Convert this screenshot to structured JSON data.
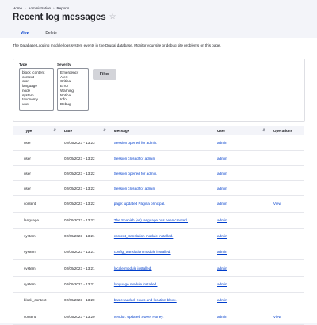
{
  "breadcrumb": [
    "Home",
    "Administration",
    "Reports"
  ],
  "breadcrumb_sep": "›",
  "page_title": "Recent log messages",
  "tabs": [
    {
      "label": "View"
    },
    {
      "label": "Delete"
    }
  ],
  "description": "The Database Logging module logs system events in the Drupal database. Monitor your site or debug site problems on this page.",
  "filter": {
    "type_label": "Type",
    "type_options": [
      "block_content",
      "content",
      "cron",
      "language",
      "node",
      "system",
      "taxonomy",
      "user"
    ],
    "severity_label": "Severity",
    "severity_options": [
      "Emergency",
      "Alert",
      "Critical",
      "Error",
      "Warning",
      "Notice",
      "Info",
      "Debug"
    ],
    "button": "Filter"
  },
  "table": {
    "headers": [
      "Type",
      "Date",
      "Message",
      "User",
      "Operations"
    ],
    "rows": [
      {
        "type": "user",
        "date": "02/09/2023 - 13:23",
        "message": "Session opened for admin.",
        "user": "admin",
        "op": ""
      },
      {
        "type": "user",
        "date": "02/09/2023 - 13:22",
        "message": "Session closed for admin.",
        "user": "admin",
        "op": ""
      },
      {
        "type": "user",
        "date": "02/09/2023 - 13:22",
        "message": "Session opened for admin.",
        "user": "admin",
        "op": ""
      },
      {
        "type": "user",
        "date": "02/09/2023 - 13:22",
        "message": "Session closed for admin.",
        "user": "admin",
        "op": ""
      },
      {
        "type": "content",
        "date": "02/09/2023 - 13:22",
        "message": "page: updated Página principal.",
        "user": "admin",
        "op": "View"
      },
      {
        "type": "language",
        "date": "02/09/2023 - 13:22",
        "message": "The Spanish (es) language has been created.",
        "user": "admin",
        "op": ""
      },
      {
        "type": "system",
        "date": "02/09/2023 - 13:21",
        "message": "content_translation module installed.",
        "user": "admin",
        "op": ""
      },
      {
        "type": "system",
        "date": "02/09/2023 - 13:21",
        "message": "config_translation module installed.",
        "user": "admin",
        "op": ""
      },
      {
        "type": "system",
        "date": "02/09/2023 - 13:21",
        "message": "locale module installed.",
        "user": "admin",
        "op": ""
      },
      {
        "type": "system",
        "date": "02/09/2023 - 13:21",
        "message": "language module installed.",
        "user": "admin",
        "op": ""
      },
      {
        "type": "block_content",
        "date": "02/09/2023 - 13:20",
        "message": "basic: added Hours and location block.",
        "user": "admin",
        "op": ""
      },
      {
        "type": "content",
        "date": "02/09/2023 - 13:20",
        "message": "vendor: updated Sweet Honey.",
        "user": "admin",
        "op": "View"
      }
    ]
  },
  "colors": {
    "accent": "#003ecc",
    "page_bg": "#f3f4f9"
  }
}
